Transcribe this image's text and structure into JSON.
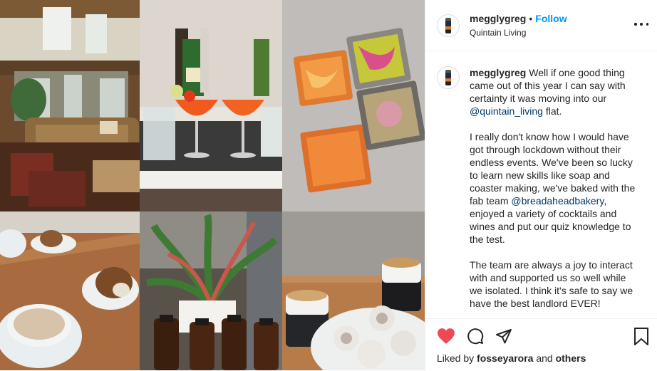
{
  "post": {
    "username": "megglygreg",
    "follow_separator": "•",
    "follow_label": "Follow",
    "location": "Quintain Living",
    "caption": {
      "p1_intro": " Well if one good thing came out of this year I can say with certainty it was moving into our ",
      "p1_mention": "@quintain_living",
      "p1_end": " flat.",
      "p2_start": "I really don't know how I would have got through lockdown without their endless events. We've been so lucky to learn new skills like soap and coaster making, we've baked with the fab team ",
      "p2_mention": "@breadaheadbakery",
      "p2_end": ", enjoyed a variety of cocktails and wines and put our quiz knowledge to the test.",
      "p3": "The team are always a joy to interact with and supported us so well while we isolated. I think it's safe to say we have the best landlord EVER!"
    },
    "likes": {
      "prefix": "Liked by ",
      "user": "fosseyarora",
      "joiner": " and ",
      "others": "others"
    }
  },
  "icons": {
    "like": "heart-icon",
    "comment": "comment-icon",
    "share": "paper-plane-icon",
    "save": "bookmark-icon",
    "more": "more-options-icon"
  },
  "colors": {
    "like_red": "#ed4956",
    "follow_blue": "#0095f6",
    "mention_blue": "#00376b"
  }
}
